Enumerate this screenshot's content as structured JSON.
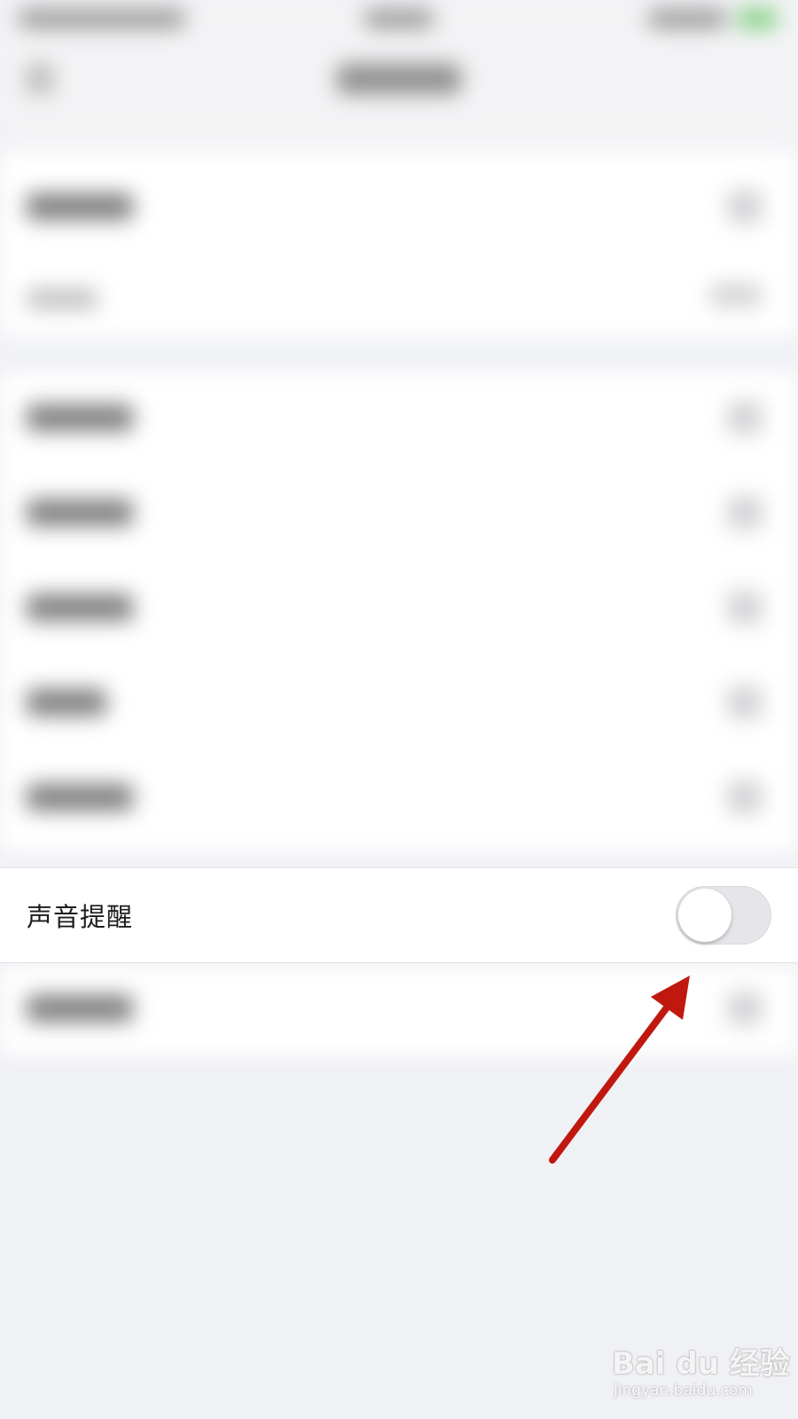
{
  "settings": {
    "sound_reminder": {
      "label": "声音提醒",
      "enabled": false
    }
  },
  "watermark": {
    "brand": "Bai du 经验",
    "domain": "jingyan.baidu.com"
  },
  "colors": {
    "arrow": "#c0180f",
    "toggle_off": "#e6e6ea",
    "page_background": "#f0f1f5"
  }
}
